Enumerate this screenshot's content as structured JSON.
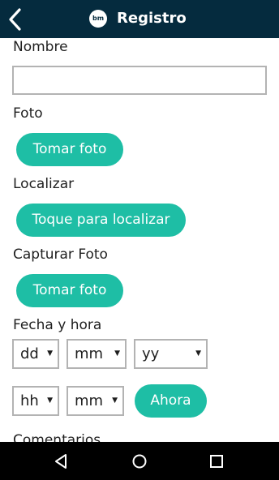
{
  "header": {
    "title": "Registro",
    "logo_text": "bm",
    "back_icon": "chevron-left-icon"
  },
  "form": {
    "nombre_label": "Nombre",
    "nombre_value": "",
    "foto_label": "Foto",
    "foto_button": "Tomar foto",
    "localizar_label": "Localizar",
    "localizar_button": "Toque para localizar",
    "capturar_label": "Capturar Foto",
    "capturar_button": "Tomar foto",
    "fecha_label": "Fecha y hora",
    "day_select": "dd",
    "month_select": "mm",
    "year_select": "yy",
    "hour_select": "hh",
    "minute_select": "mm",
    "now_button": "Ahora",
    "comentarios_label": "Comentarios",
    "caret": "▼"
  },
  "navbar": {
    "back_icon": "triangle-back-icon",
    "home_icon": "circle-home-icon",
    "recents_icon": "square-recents-icon"
  },
  "colors": {
    "appbar": "#052b3e",
    "accent": "#1ebea5",
    "input_border": "#b3b3b3",
    "navbar": "#000000"
  }
}
